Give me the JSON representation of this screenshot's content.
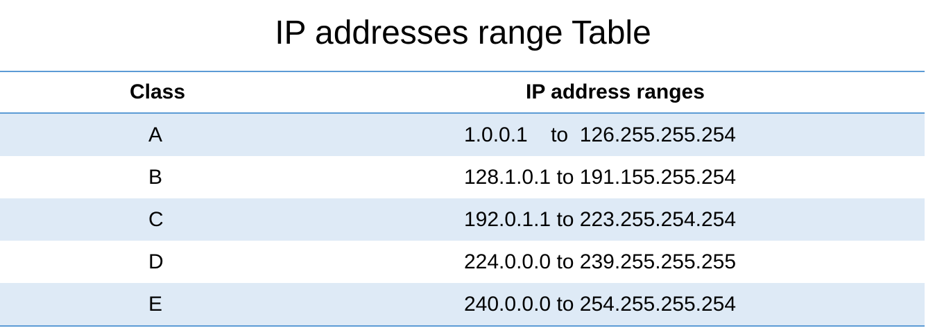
{
  "title": "IP addresses range Table",
  "table": {
    "headers": [
      "Class",
      "IP address ranges"
    ],
    "rows": [
      {
        "class": "A",
        "range": "1.0.0.1    to  126.255.255.254"
      },
      {
        "class": "B",
        "range": "128.1.0.1 to 191.155.255.254"
      },
      {
        "class": "C",
        "range": "192.0.1.1 to 223.255.254.254"
      },
      {
        "class": "D",
        "range": "224.0.0.0 to 239.255.255.255"
      },
      {
        "class": "E",
        "range": "240.0.0.0 to 254.255.255.254"
      }
    ]
  },
  "colors": {
    "border": "#5b9bd5",
    "band": "#deeaf6",
    "text": "#000000",
    "background": "#ffffff"
  }
}
